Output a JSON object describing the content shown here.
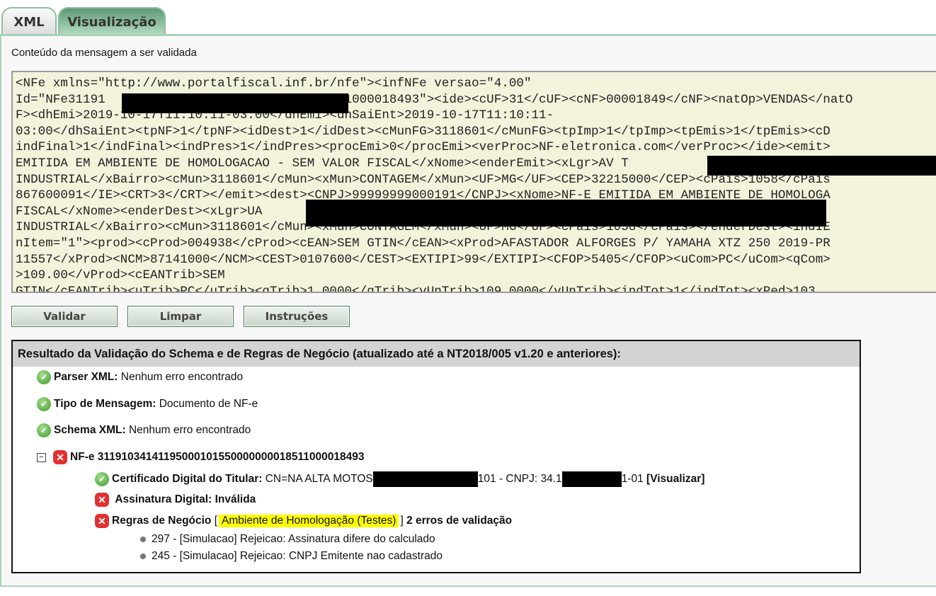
{
  "tabs": [
    {
      "label": "XML",
      "active": false
    },
    {
      "label": "Visualização",
      "active": true
    }
  ],
  "content_label": "Conteúdo da mensagem a ser validada",
  "xml_lines": [
    "<NFe xmlns=\"http://www.portalfiscal.inf.br/nfe\"><infNFe versao=\"4.00\"",
    "Id=\"NFe31191                              511000018493\"><ide><cUF>31</cUF><cNF>00001849</cNF><natOp>VENDAS</natO",
    "F><dhEmi>2019-10-17T11:10:11-03:00</dhEmi><dhSaiEnt>2019-10-17T11:10:11-",
    "03:00</dhSaiEnt><tpNF>1</tpNF><idDest>1</idDest><cMunFG>3118601</cMunFG><tpImp>1</tpImp><tpEmis>1</tpEmis><cD",
    "indFinal>1</indFinal><indPres>1</indPres><procEmi>0</procEmi><verProc>NF-eletronica.com</verProc></ide><emit>",
    "EMITIDA EM AMBIENTE DE HOMOLOGACAO - SEM VALOR FISCAL</xNome><enderEmit><xLgr>AV T",
    "INDUSTRIAL</xBairro><cMun>3118601</cMun><xMun>CONTAGEM</xMun><UF>MG</UF><CEP>32215000</CEP><cPais>1058</cPais",
    "867600091</IE><CRT>3</CRT></emit><dest><CNPJ>99999999000191</CNPJ><xNome>NF-E EMITIDA EM AMBIENTE DE HOMOLOGA",
    "FISCAL</xNome><enderDest><xLgr>UA ",
    "INDUSTRIAL</xBairro><cMun>3118601</cMun><xMun>CONTAGEM</xMun><UF>MG</UF><cPais>1058</cPais></enderDest><indIE",
    "nItem=\"1\"><prod><cProd>004938</cProd><cEAN>SEM GTIN</cEAN><xProd>AFASTADOR ALFORGES P/ YAMAHA XTZ 250 2019-PR",
    "11557</xProd><NCM>87141000</NCM><CEST>0107600</CEST><EXTIPI>99</EXTIPI><CFOP>5405</CFOP><uCom>PC</uCom><qCom>",
    ">109.00</vProd><cEANTrib>SEM",
    "GTIN</cEANTrib><uTrib>PC</uTrib><qTrib>1.0000</qTrib><vUnTrib>109.0000</vUnTrib><indTot>1</indTot><xPed>103"
  ],
  "buttons": {
    "validate": "Validar",
    "clear": "Limpar",
    "instructions": "Instruções"
  },
  "result": {
    "title": "Resultado da Validação do Schema e de Regras de Negócio (atualizado até a NT2018/005 v1.20 e anteriores):",
    "parser": {
      "label": "Parser XML:",
      "value": "Nenhum erro encontrado",
      "status": "ok"
    },
    "msg_type": {
      "label": "Tipo de Mensagem:",
      "value": "Documento de NF-e",
      "status": "ok"
    },
    "schema": {
      "label": "Schema XML:",
      "value": "Nenhum erro encontrado",
      "status": "ok"
    },
    "nfe": {
      "label": "NF-e 31191034141195000101550000000018511000018493",
      "status": "error",
      "certificate": {
        "label": "Certificado Digital do Titular:",
        "value_a": "CN=NA ALTA MOTOS",
        "value_b": "101 - CNPJ: 34.1",
        "value_c": "1-01",
        "link": "[Visualizar]",
        "status": "ok"
      },
      "signature": {
        "label": "Assinatura Digital:",
        "value": "Inválida",
        "status": "error"
      },
      "rules": {
        "label": "Regras de Negócio",
        "environment": "Ambiente de Homologação (Testes)",
        "summary": "2 erros de validação",
        "status": "error",
        "errors": [
          "297 - [Simulacao] Rejeicao: Assinatura difere do calculado",
          "245 - [Simulacao] Rejeicao: CNPJ Emitente nao cadastrado"
        ]
      }
    }
  },
  "colors": {
    "ok": "#3d9a2f",
    "error": "#e23030",
    "highlight": "#ffff00",
    "tab_active": "#5e9a74"
  }
}
